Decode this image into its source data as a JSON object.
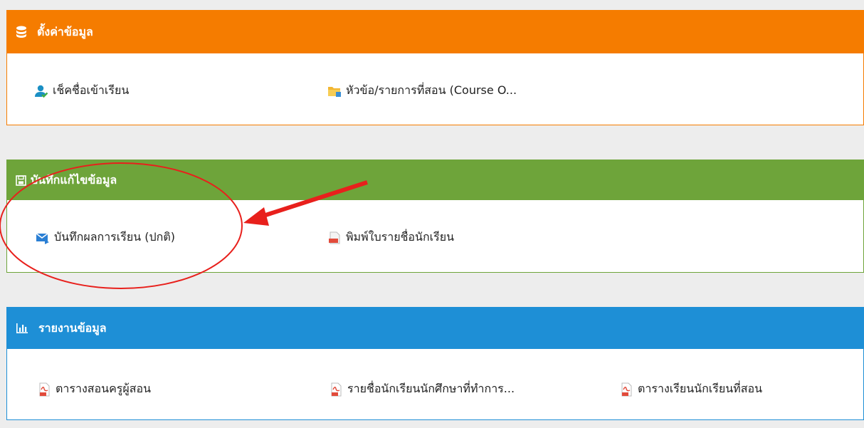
{
  "colors": {
    "settings": "#f57c00",
    "record": "#6ea43a",
    "report": "#1e8fd6",
    "annotation": "#e8201c"
  },
  "settings": {
    "title": "ตั้งค่าข้อมูล",
    "icon": "database-icon",
    "items": [
      {
        "label": "เช็คชื่อเข้าเรียน",
        "icon": "user-check-icon"
      },
      {
        "label": "หัวข้อ/รายการที่สอน (Course O...",
        "icon": "folder-icon"
      }
    ]
  },
  "record": {
    "title": "บันทึกแก้ไขข้อมูล",
    "icon": "save-icon",
    "items": [
      {
        "label": "บันทึกผลการเรียน (ปกติ)",
        "icon": "envelope-icon"
      },
      {
        "label": "พิมพ์ใบรายชื่อนักเรียน",
        "icon": "pdf-icon"
      }
    ]
  },
  "report": {
    "title": "รายงานข้อมูล",
    "icon": "bar-chart-icon",
    "items": [
      {
        "label": "ตารางสอนครูผู้สอน",
        "icon": "pdf-icon"
      },
      {
        "label": "รายชื่อนักเรียนนักศึกษาที่ทำการ...",
        "icon": "pdf-icon"
      },
      {
        "label": "ตารางเรียนนักเรียนที่สอน",
        "icon": "pdf-icon"
      }
    ]
  }
}
